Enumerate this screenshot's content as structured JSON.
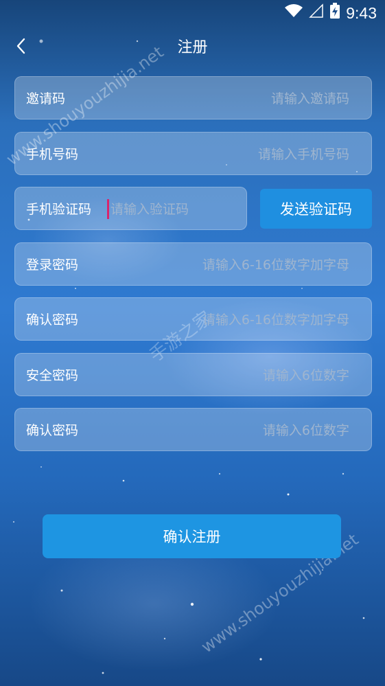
{
  "status_bar": {
    "time": "9:43",
    "icons": [
      "wifi-icon",
      "signal-icon",
      "battery-charging-icon"
    ]
  },
  "header": {
    "title": "注册",
    "back_icon": "chevron-left-icon"
  },
  "form": {
    "invite_code": {
      "label": "邀请码",
      "placeholder": "请输入邀请码"
    },
    "phone": {
      "label": "手机号码",
      "placeholder": "请输入手机号码"
    },
    "sms_code": {
      "label": "手机验证码",
      "placeholder": "请输入验证码"
    },
    "login_password": {
      "label": "登录密码",
      "placeholder": "请输入6-16位数字加字母"
    },
    "confirm_password": {
      "label": "确认密码",
      "placeholder": "请输入6-16位数字加字母"
    },
    "security_password": {
      "label": "安全密码",
      "placeholder": "请输入6位数字"
    },
    "confirm_security_password": {
      "label": "确认密码",
      "placeholder": "请输入6位数字"
    }
  },
  "buttons": {
    "send_code": "发送验证码",
    "submit": "确认注册"
  },
  "watermark": {
    "url": "www.shouyouzhijia.net",
    "name": "手游之家"
  }
}
